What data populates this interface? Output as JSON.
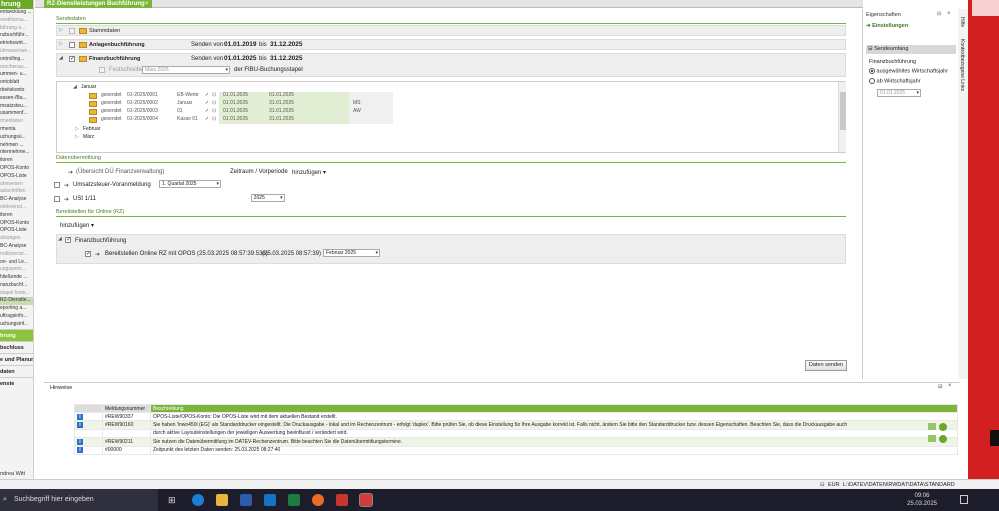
{
  "nav": {
    "header": "hrung",
    "items": [
      {
        "label": "entwicklung ...",
        "style": "normal"
      },
      {
        "label": "vestitionsa...",
        "style": "gray"
      },
      {
        "label": "führung a...",
        "style": "gray"
      },
      {
        "label": "nzbuchführ...",
        "style": "normal"
      },
      {
        "label": "etriebswirt...",
        "style": "normal"
      },
      {
        "label": "ührwarenwe...",
        "style": "gray"
      },
      {
        "label": "ontrolling...",
        "style": "normal"
      },
      {
        "label": "ranchenau...",
        "style": "gray"
      },
      {
        "label": "ummen- u...",
        "style": "normal"
      },
      {
        "label": "ontoblatt",
        "style": "normal"
      },
      {
        "label": "rbeitskonto",
        "style": "normal"
      },
      {
        "label": "essen-/Ba...",
        "style": "normal"
      },
      {
        "label": "msatzsteu...",
        "style": "normal"
      },
      {
        "label": "usammenf...",
        "style": "normal"
      },
      {
        "label": "rmenlisten",
        "style": "gray"
      },
      {
        "label": "rmenta",
        "style": "normal"
      },
      {
        "label": "uchungsü...",
        "style": "normal"
      },
      {
        "label": "nehmen ...",
        "style": "normal"
      },
      {
        "label": "ntermehme...",
        "style": "normal"
      },
      {
        "label": "itoren",
        "style": "normal"
      },
      {
        "label": "OPOS-Konto",
        "style": "normal"
      },
      {
        "label": "OPOS-Liste",
        "style": "normal"
      },
      {
        "label": "ahnwesen",
        "style": "gray"
      },
      {
        "label": "astschriften",
        "style": "gray"
      },
      {
        "label": "BC-Analyse",
        "style": "normal"
      },
      {
        "label": "ebitorenst...",
        "style": "gray"
      },
      {
        "label": "itoren",
        "style": "normal"
      },
      {
        "label": "OPOS-Konto",
        "style": "normal"
      },
      {
        "label": "OPOS-Liste",
        "style": "normal"
      },
      {
        "label": "ahlungen",
        "style": "gray"
      },
      {
        "label": "BC-Analyse",
        "style": "normal"
      },
      {
        "label": "reditorenst...",
        "style": "gray"
      },
      {
        "label": "on- und Le...",
        "style": "normal"
      },
      {
        "label": "ungsperio...",
        "style": "gray"
      },
      {
        "label": "hließende ...",
        "style": "normal"
      },
      {
        "label": "nanzbuchf...",
        "style": "normal"
      },
      {
        "label": "stapel feste...",
        "style": "gray"
      },
      {
        "label": "RZ-Dienstle...",
        "style": "sel"
      },
      {
        "label": "eporting a...",
        "style": "normal"
      },
      {
        "label": "uftragsinfo...",
        "style": "normal"
      },
      {
        "label": "uchungsinf...",
        "style": "normal"
      }
    ],
    "sections": [
      {
        "label": "hrung",
        "active": true
      },
      {
        "label": "bschluss",
        "active": false
      },
      {
        "label": "e und Planung",
        "active": false
      },
      {
        "label": "daten",
        "active": false
      },
      {
        "label": "enste",
        "active": false
      }
    ],
    "user": "ndrea Witt"
  },
  "tab": {
    "title": "RZ-Dienstleistungen Buchführung",
    "close": "×"
  },
  "senden": {
    "title": "Sendedaten",
    "stammdaten": "Stammdaten",
    "anlagen": {
      "label": "Anlagenbuchführung",
      "von_label": "Senden von",
      "von": "01.01.2019",
      "bis_label": "bis",
      "bis": "31.12.2025"
    },
    "finanz": {
      "label": "Finanzbuchführung",
      "von_label": "Senden von",
      "von": "01.01.2025",
      "bis_label": "bis",
      "bis": "31.12.2025"
    },
    "festschreiben": {
      "label": "Festschreiben bis",
      "value": "März 2025",
      "suffix": "der FIBU-Buchungsstapel"
    },
    "months": {
      "jan": "Januar",
      "feb": "Februar",
      "mar": "März"
    },
    "rows": [
      {
        "status": "gesendet",
        "nr": "01-2025/0001",
        "name": "EB-Werte",
        "d1": "01.01.2025",
        "d2": "01.01.2025",
        "extra": ""
      },
      {
        "status": "gesendet",
        "nr": "01-2025/0002",
        "name": "Januar",
        "d1": "01.01.2025",
        "d2": "31.01.2025",
        "extra": "MS"
      },
      {
        "status": "gesendet",
        "nr": "01-2025/0003",
        "name": "01",
        "d1": "01.01.2025",
        "d2": "31.01.2025",
        "extra": "AW"
      },
      {
        "status": "gesendet",
        "nr": "01-2025/0004",
        "name": "Kasse 01",
        "d1": "01.01.2025",
        "d2": "31.01.2025",
        "extra": ""
      }
    ]
  },
  "daten": {
    "title": "Datenübermittlung",
    "uebersicht": "(Übersicht DÜ Finanzverwaltung)",
    "zeitraum_label": "Zeitraum / Vorperiode",
    "hinzufuegen": "hinzufügen",
    "ustva": {
      "label": "Umsatzsteuer-Voranmeldung",
      "value": "1. Quartal 2025"
    },
    "ust": {
      "label": "USt 1/11",
      "value": "2025"
    }
  },
  "online": {
    "title": "Bereitstellen für Online (RZ)",
    "hinzufuegen": "hinzufügen",
    "group": "Finanzbuchführung",
    "item_label": "Bereitstellen Online RZ mit OPOS (25.03.2025 08:57:39.538)",
    "item_date": "(25.03.2025 08:57:39)",
    "item_value": "Februar 2025"
  },
  "send_button": "Daten senden",
  "props": {
    "title": "Eigenschaften",
    "einstellungen": "Einstellungen",
    "sendeumfang": "Sendeumfang",
    "finanz": "Finanzbuchführung",
    "opt1": "ausgewähltes Wirtschaftsjahr",
    "opt2": "ab Wirtschaftsjahr",
    "date": "01.01.2025"
  },
  "sidetabs": {
    "hilfe": "Hilfe",
    "links": "Kontextbezogene Links"
  },
  "hints": {
    "title": "Hinweise",
    "col_nr": "Meldungsnummer",
    "col_desc": "Beschreibung",
    "rows": [
      {
        "nr": "#REW90337",
        "desc": "OPOS-Liste/OPOS-Konto: Die OPOS-Liste wird mit dem aktuellen Bestand erstellt."
      },
      {
        "nr": "#REW90160",
        "desc": "Sie haben 'lnwo450i (EG)' als Standarddrucker eingestellt. Die Druckausgabe - lokal und im Rechenzentrum - erfolgt 'duplex'. Bitte prüfen Sie, ob diese Einstellung für Ihre Ausgabe korrekt ist. Falls nicht, ändern Sie bitte den Standarddrucker bzw. dessen Eigenschaften. Beachten Sie, dass die Druckausgabe auch"
      },
      {
        "nr": "",
        "desc": "durch aktive Layouteinstellungen der jeweiligen Auswertung beeinflusst / verändert wird."
      },
      {
        "nr": "#REW90211",
        "desc": "Sie nutzen die Datenübermittlung im DATEV-Rechenzentrum. Bitte beachten Sie die Datenübermittlungstermine."
      },
      {
        "nr": "#00000",
        "desc": "Zeitpunkt des letzten Daten senden: 25.03.2025 08:27:40"
      }
    ]
  },
  "status": {
    "currency": "EUR",
    "path": "L:\\DATEV\\DATEN\\RWDAT\\DATA\\STANDARD"
  },
  "taskbar": {
    "search": "Suchbegriff hier eingeben",
    "time": "09:06",
    "date": "25.03.2025"
  }
}
